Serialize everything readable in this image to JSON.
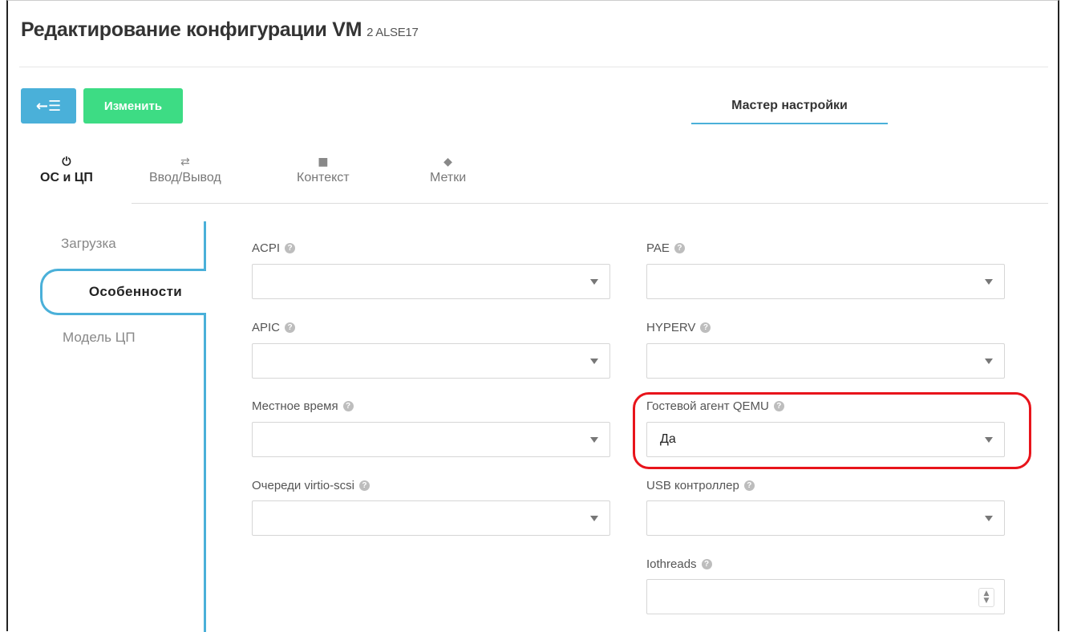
{
  "header": {
    "title": "Редактирование конфигурации VM",
    "subtitle": "2 ALSE17"
  },
  "toolbar": {
    "back_icon": "←☰",
    "edit_label": "Изменить",
    "wizard_label": "Мастер настройки"
  },
  "tabs": [
    {
      "icon": "power-icon",
      "glyph": "⏻",
      "label": "ОС и ЦП",
      "active": true
    },
    {
      "icon": "exchange-icon",
      "glyph": "⇄",
      "label": "Ввод/Вывод",
      "active": false
    },
    {
      "icon": "folder-icon",
      "glyph": "■",
      "label": "Контекст",
      "active": false
    },
    {
      "icon": "tag-icon",
      "glyph": "◆",
      "label": "Метки",
      "active": false
    }
  ],
  "sidenav": [
    {
      "label": "Загрузка",
      "active": false
    },
    {
      "label": "Особенности",
      "active": true
    },
    {
      "label": "Модель ЦП",
      "active": false
    }
  ],
  "help_glyph": "?",
  "fields": {
    "acpi": {
      "label": "ACPI",
      "value": ""
    },
    "pae": {
      "label": "PAE",
      "value": ""
    },
    "apic": {
      "label": "APIC",
      "value": ""
    },
    "hyperv": {
      "label": "HYPERV",
      "value": ""
    },
    "localtime": {
      "label": "Местное время",
      "value": ""
    },
    "qemu_agent": {
      "label": "Гостевой агент QEMU",
      "value": "Да"
    },
    "virtio_scsi": {
      "label": "Очереди virtio-scsi",
      "value": ""
    },
    "usb": {
      "label": "USB контроллер",
      "value": ""
    },
    "iothreads": {
      "label": "Iothreads",
      "value": ""
    }
  },
  "colors": {
    "accent": "#4ab0d9",
    "edit": "#3ddc84",
    "highlight": "#e8141b"
  }
}
